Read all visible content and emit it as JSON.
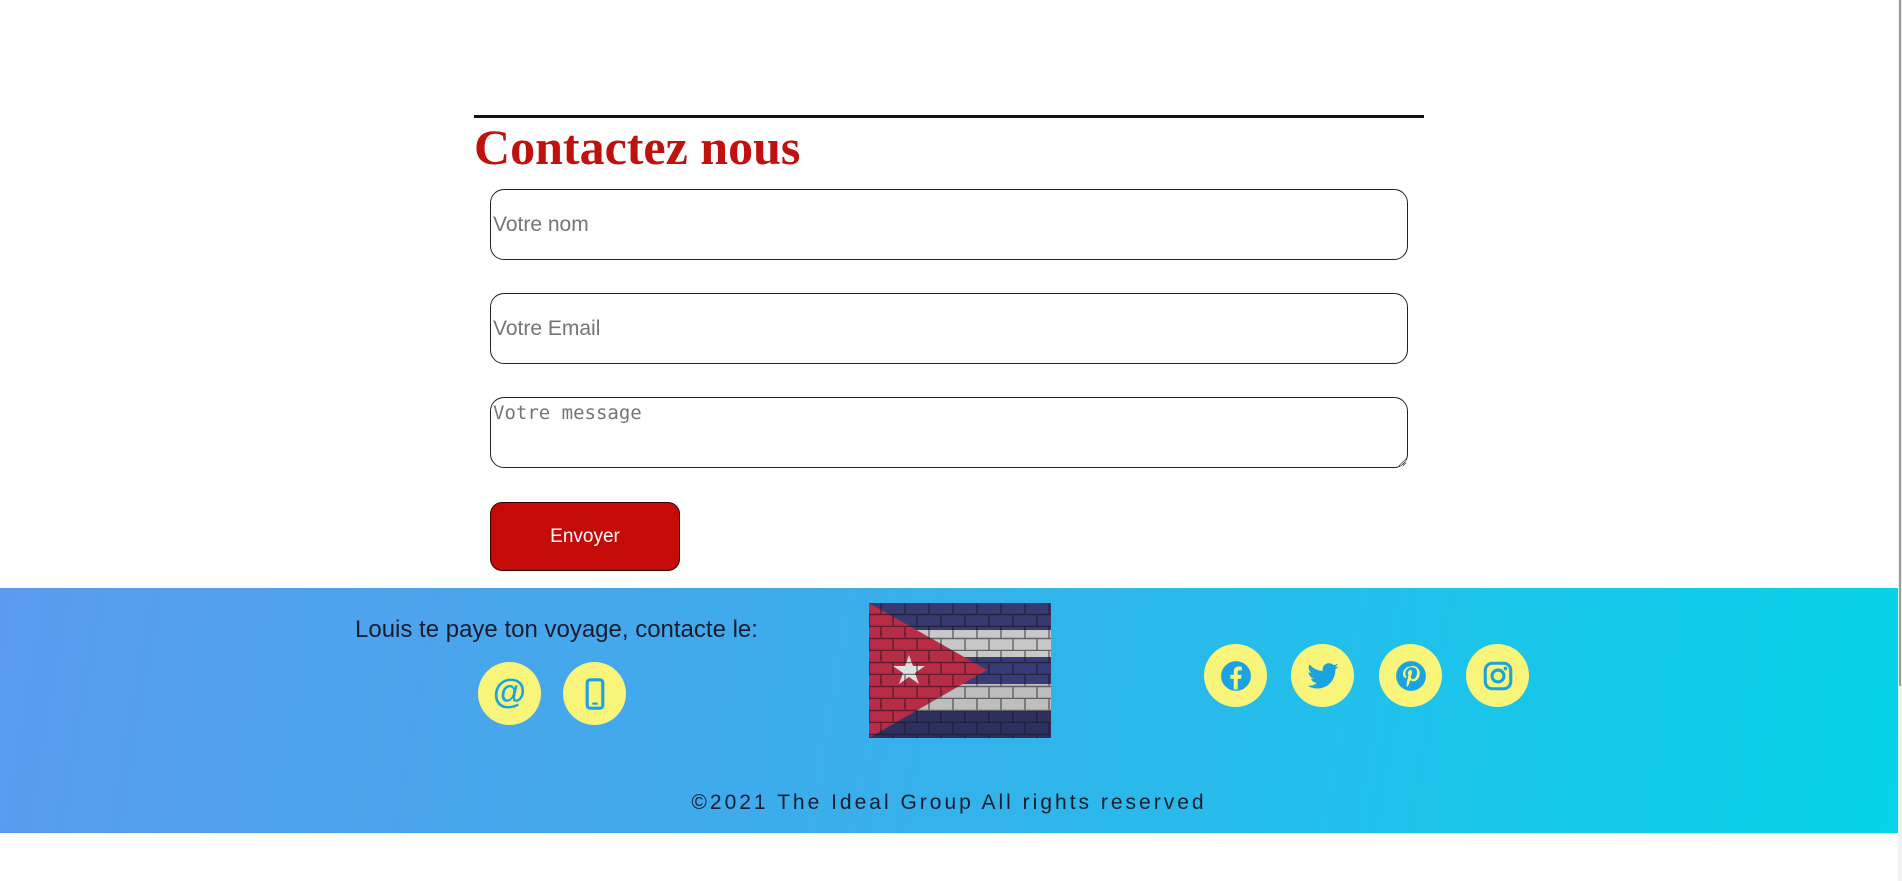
{
  "contact": {
    "title": "Contactez nous",
    "name_placeholder": "Votre nom",
    "email_placeholder": "Votre Email",
    "message_placeholder": "Votre message",
    "send_label": "Envoyer"
  },
  "footer": {
    "tagline": "Louis te paye ton voyage, contacte le:",
    "contact_icons": [
      "at-sign-icon",
      "mobile-phone-icon"
    ],
    "flag_image": "cuba-flag-brick-wall",
    "social_icons": [
      "facebook-icon",
      "twitter-icon",
      "pinterest-icon",
      "instagram-icon"
    ],
    "copyright": "©2021 The Ideal Group All rights reserved"
  },
  "colors": {
    "title_red": "#c1110f",
    "button_red": "#c40b08",
    "icon_circle_yellow": "#f8f57a",
    "icon_blue": "#19a3e1",
    "gradient_start": "#5b9bef",
    "gradient_end": "#05d4ea"
  }
}
